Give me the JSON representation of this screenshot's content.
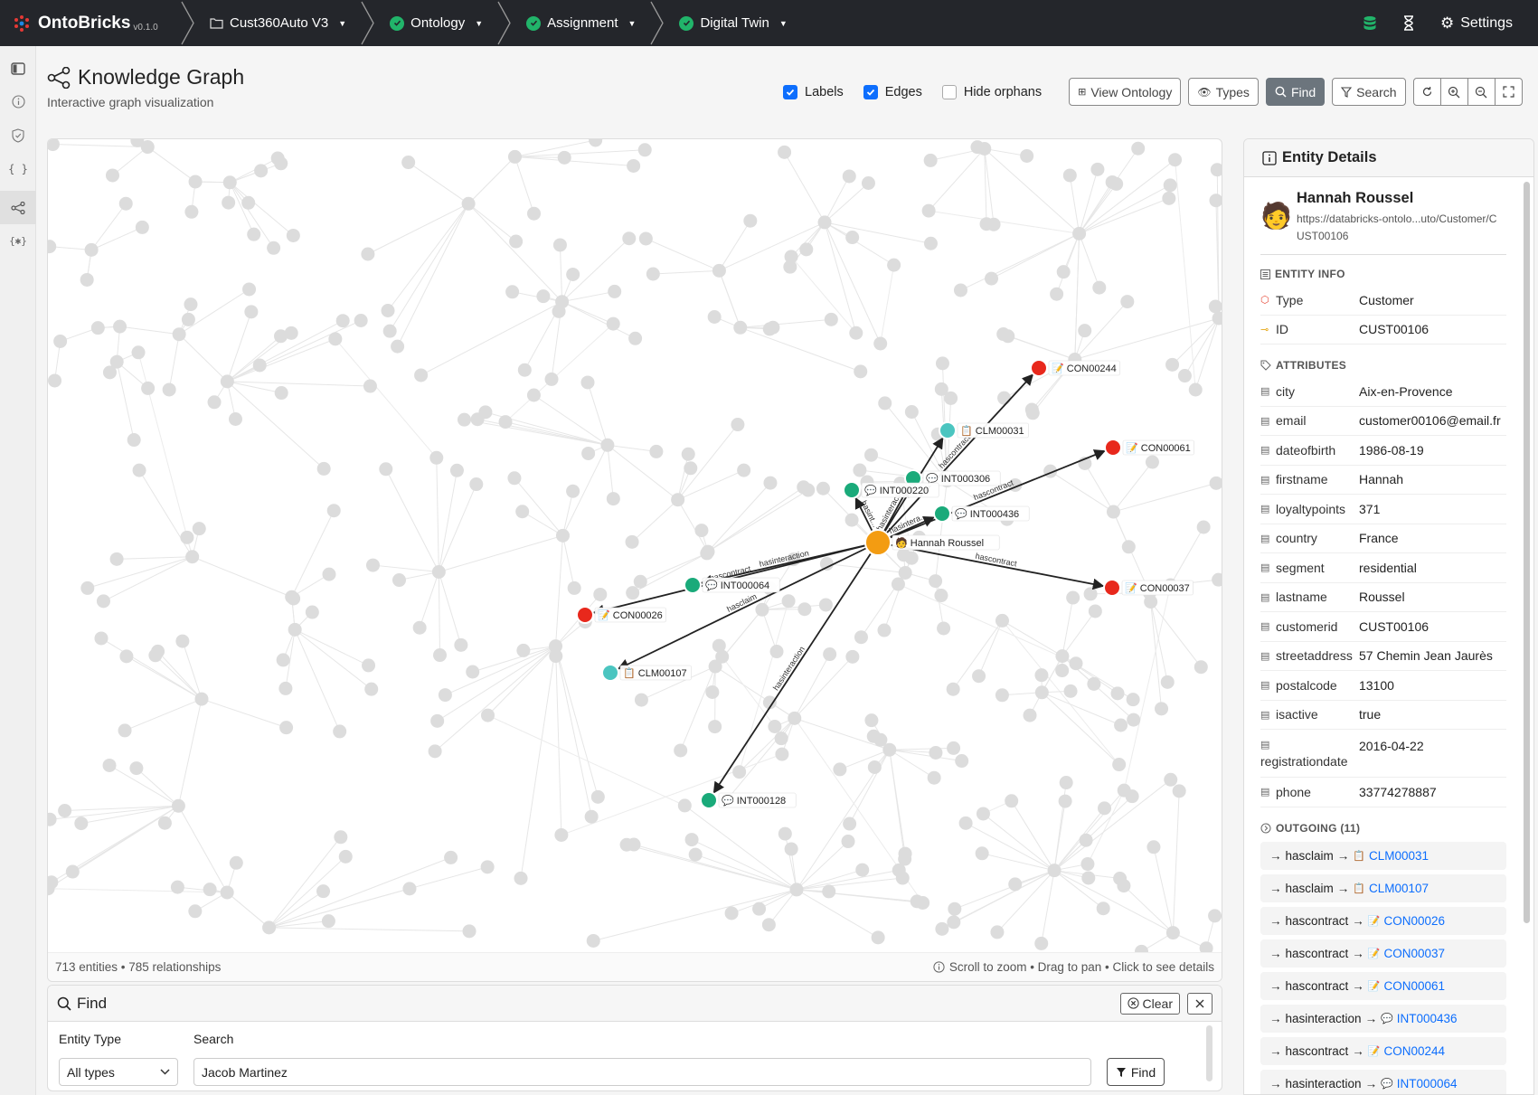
{
  "brand": {
    "name": "OntoBricks",
    "version": "v0.1.0"
  },
  "nav": {
    "project": "Cust360Auto V3",
    "ontology": "Ontology",
    "assignment": "Assignment",
    "digital_twin": "Digital Twin",
    "settings": "Settings"
  },
  "page": {
    "title": "Knowledge Graph",
    "subtitle": "Interactive graph visualization"
  },
  "toolbar": {
    "labels": "Labels",
    "labels_checked": true,
    "edges": "Edges",
    "edges_checked": true,
    "hide_orphans": "Hide orphans",
    "hide_orphans_checked": false,
    "view_ontology": "View Ontology",
    "types": "Types",
    "find": "Find",
    "search": "Search"
  },
  "graph": {
    "stats": "713 entities • 785 relationships",
    "hint": "Scroll to zoom • Drag to pan • Click to see details",
    "nodes": [
      {
        "id": "hannah",
        "label": "Hannah Roussel",
        "icon": "🧑",
        "color": "#f39c12",
        "focus": true
      },
      {
        "id": "CON00244",
        "label": "CON00244",
        "icon": "📝",
        "color": "#e8281c"
      },
      {
        "id": "CLM00031",
        "label": "CLM00031",
        "icon": "📋",
        "color": "#4bc5c0"
      },
      {
        "id": "CON00061",
        "label": "CON00061",
        "icon": "📝",
        "color": "#e8281c"
      },
      {
        "id": "INT000306",
        "label": "INT000306",
        "icon": "💬",
        "color": "#1aaa7a"
      },
      {
        "id": "INT000220",
        "label": "INT000220",
        "icon": "💬",
        "color": "#1aaa7a"
      },
      {
        "id": "INT000436",
        "label": "INT000436",
        "icon": "💬",
        "color": "#1aaa7a"
      },
      {
        "id": "CON00037",
        "label": "CON00037",
        "icon": "📝",
        "color": "#e8281c"
      },
      {
        "id": "INT000064",
        "label": "INT000064",
        "icon": "💬",
        "color": "#1aaa7a"
      },
      {
        "id": "CON00026",
        "label": "CON00026",
        "icon": "📝",
        "color": "#e8281c"
      },
      {
        "id": "CLM00107",
        "label": "CLM00107",
        "icon": "📋",
        "color": "#4bc5c0"
      },
      {
        "id": "INT000128",
        "label": "INT000128",
        "icon": "💬",
        "color": "#1aaa7a"
      }
    ],
    "edges": [
      {
        "to": "CON00244",
        "label": "hascontract"
      },
      {
        "to": "CLM00031",
        "label": "hasclaim"
      },
      {
        "to": "CON00061",
        "label": "hascontract"
      },
      {
        "to": "INT000306",
        "label": "hasinteraction"
      },
      {
        "to": "INT000220",
        "label": "hasint..."
      },
      {
        "to": "INT000436",
        "label": "hasintera..."
      },
      {
        "to": "CON00037",
        "label": "hascontract"
      },
      {
        "to": "INT000064",
        "label": "hasinteraction"
      },
      {
        "to": "CON00026",
        "label": "hascontract"
      },
      {
        "to": "CLM00107",
        "label": "hasclaim"
      },
      {
        "to": "INT000128",
        "label": "hasinteraction"
      }
    ]
  },
  "find_panel": {
    "title": "Find",
    "clear": "Clear",
    "entity_type_label": "Entity Type",
    "entity_type_value": "All types",
    "search_label": "Search",
    "search_value": "Jacob Martinez",
    "find_button": "Find"
  },
  "details": {
    "title": "Entity Details",
    "name": "Hannah Roussel",
    "emoji": "🧑",
    "uri": "https://databricks-ontolo...uto/Customer/CUST00106",
    "entity_info_title": "ENTITY INFO",
    "entity_info": [
      {
        "key": "Type",
        "value": "Customer",
        "icon_color": "#e74c3c"
      },
      {
        "key": "ID",
        "value": "CUST00106",
        "icon_color": "#e6a817"
      }
    ],
    "attributes_title": "ATTRIBUTES",
    "attributes": [
      {
        "key": "city",
        "value": "Aix-en-Provence"
      },
      {
        "key": "email",
        "value": "customer00106@email.fr"
      },
      {
        "key": "dateofbirth",
        "value": "1986-08-19"
      },
      {
        "key": "firstname",
        "value": "Hannah"
      },
      {
        "key": "loyaltypoints",
        "value": "371"
      },
      {
        "key": "country",
        "value": "France"
      },
      {
        "key": "segment",
        "value": "residential"
      },
      {
        "key": "lastname",
        "value": "Roussel"
      },
      {
        "key": "customerid",
        "value": "CUST00106"
      },
      {
        "key": "streetaddress",
        "value": "57 Chemin Jean Jaurès"
      },
      {
        "key": "postalcode",
        "value": "13100"
      },
      {
        "key": "isactive",
        "value": "true"
      },
      {
        "key": "registrationdate",
        "value": "2016-04-22"
      },
      {
        "key": "phone",
        "value": "33774278887"
      }
    ],
    "outgoing_title": "OUTGOING (11)",
    "outgoing": [
      {
        "rel": "hasclaim",
        "icon": "📋",
        "target": "CLM00031"
      },
      {
        "rel": "hasclaim",
        "icon": "📋",
        "target": "CLM00107"
      },
      {
        "rel": "hascontract",
        "icon": "📝",
        "target": "CON00026"
      },
      {
        "rel": "hascontract",
        "icon": "📝",
        "target": "CON00037"
      },
      {
        "rel": "hascontract",
        "icon": "📝",
        "target": "CON00061"
      },
      {
        "rel": "hasinteraction",
        "icon": "💬",
        "target": "INT000436"
      },
      {
        "rel": "hascontract",
        "icon": "📝",
        "target": "CON00244"
      },
      {
        "rel": "hasinteraction",
        "icon": "💬",
        "target": "INT000064"
      }
    ]
  }
}
